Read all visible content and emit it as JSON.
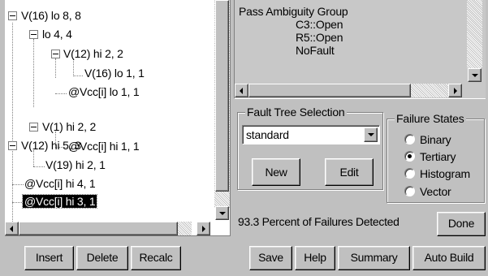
{
  "tree": {
    "nodes": [
      {
        "label": "V(16) lo  8, 8"
      },
      {
        "label": "lo  4, 4"
      },
      {
        "label": "V(12) hi  2, 2"
      },
      {
        "label": "V(16) lo  1, 1"
      },
      {
        "label": "@Vcc[i] lo  1, 1"
      },
      {
        "label": "V(1) hi  2, 2"
      },
      {
        "label": "@Vcc[i] hi  1, 1"
      },
      {
        "label": "V(12) hi  5, 3"
      },
      {
        "label": "V(19) hi  2, 1"
      },
      {
        "label": "@Vcc[i] hi  4, 1"
      },
      {
        "label": "@Vcc[i] hi  3, 1"
      }
    ],
    "selected_index": 10
  },
  "pass_group": {
    "lines": [
      "Pass Ambiguity Group",
      "C3::Open",
      "R5::Open",
      "NoFault"
    ]
  },
  "fault_tree": {
    "legend": "Fault Tree Selection",
    "selected": "standard",
    "new_label": "New",
    "edit_label": "Edit"
  },
  "failure_states": {
    "legend": "Failure States",
    "options": [
      {
        "label": "Binary",
        "checked": false
      },
      {
        "label": "Tertiary",
        "checked": true
      },
      {
        "label": "Histogram",
        "checked": false
      },
      {
        "label": "Vector",
        "checked": false
      }
    ]
  },
  "status": {
    "text": "93.3 Percent of Failures Detected",
    "done_label": "Done"
  },
  "toolbar_left": {
    "insert_label": "Insert",
    "delete_label": "Delete",
    "recalc_label": "Recalc"
  },
  "toolbar_right": {
    "save_label": "Save",
    "help_label": "Help",
    "summary_label": "Summary",
    "auto_build_label": "Auto Build"
  }
}
